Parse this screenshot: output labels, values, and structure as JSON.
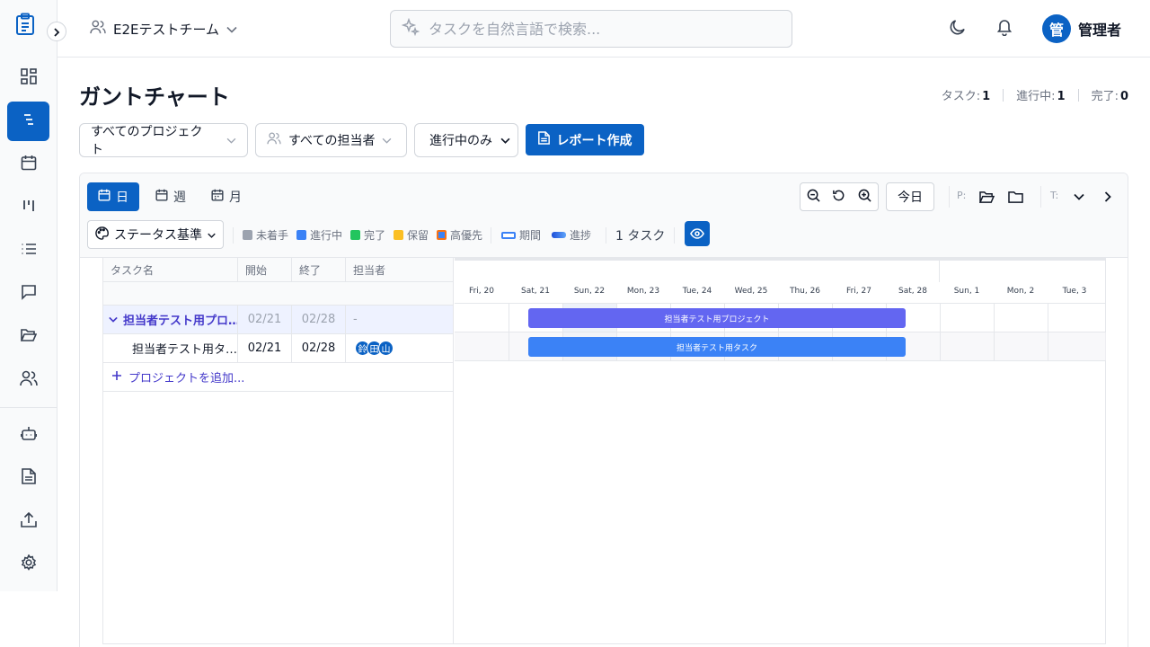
{
  "header": {
    "team_name": "E2Eテストチーム",
    "search_placeholder": "タスクを自然言語で検索...",
    "user_initial": "管",
    "user_name": "管理者"
  },
  "page": {
    "title": "ガントチャート",
    "stats": [
      {
        "label": "タスク:",
        "value": "1"
      },
      {
        "label": "進行中:",
        "value": "1"
      },
      {
        "label": "完了:",
        "value": "0"
      }
    ]
  },
  "filters": {
    "project": "すべてのプロジェクト",
    "assignee": "すべての担当者",
    "status": "進行中のみ",
    "report_button": "レポート作成"
  },
  "toolbar": {
    "views": [
      "日",
      "週",
      "月"
    ],
    "today": "今日",
    "p_label": "P:",
    "t_label": "T:",
    "color_mode": "ステータス基準",
    "legend": [
      {
        "label": "未着手",
        "color": "#9ca3af"
      },
      {
        "label": "進行中",
        "color": "#3b82f6"
      },
      {
        "label": "完了",
        "color": "#22c55e"
      },
      {
        "label": "保留",
        "color": "#fbbf24"
      },
      {
        "label": "高優先",
        "color": "#f97316"
      },
      {
        "label": "期間",
        "color": "#3b82f6"
      },
      {
        "label": "進捗",
        "color": "#2563eb"
      }
    ],
    "task_count": "1 タスク"
  },
  "table": {
    "headers": [
      "タスク名",
      "開始",
      "終了",
      "担当者"
    ],
    "project_row": {
      "name": "担当者テスト用プロ…",
      "start": "02/21",
      "end": "02/28",
      "assignee": "-"
    },
    "task_row": {
      "name": "担当者テスト用タ…",
      "start": "02/21",
      "end": "02/28",
      "assignees": [
        "鈴",
        "田",
        "山"
      ]
    },
    "add_project": "プロジェクトを追加..."
  },
  "timeline": {
    "days": [
      "Fri, 20",
      "Sat, 21",
      "Sun, 22",
      "Mon, 23",
      "Tue, 24",
      "Wed, 25",
      "Thu, 26",
      "Fri, 27",
      "Sat, 28",
      "Sun, 1",
      "Mon, 2",
      "Tue, 3"
    ],
    "project_bar": "担当者テスト用プロジェクト",
    "task_bar": "担当者テスト用タスク"
  },
  "colors": {
    "primary": "#0b62c4",
    "project_bar": "#6366f1",
    "task_bar": "#3b82f6"
  }
}
